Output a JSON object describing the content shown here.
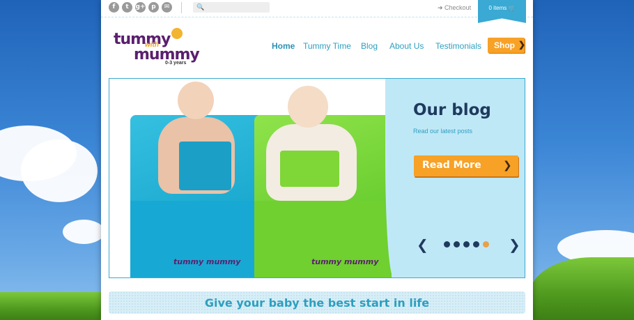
{
  "social": [
    "f",
    "t",
    "g+",
    "p",
    "✉"
  ],
  "search": {
    "icon": "🔍"
  },
  "header": {
    "checkout": "Checkout",
    "cart": "0 items"
  },
  "logo": {
    "line1": "tummy",
    "with": "with",
    "line2": "mummy",
    "age": "0-3 years"
  },
  "nav": [
    "Home",
    "Tummy Time",
    "Blog",
    "About Us",
    "Testimonials"
  ],
  "shop": {
    "label": "Shop",
    "arrow": "❯"
  },
  "slide": {
    "title": "Our blog",
    "subtitle": "Read our latest posts",
    "button": "Read More",
    "button_arrow": "❯",
    "prev": "❮",
    "next": "❯",
    "chair_logo": "tummy mummy"
  },
  "tagline": "Give your baby the best start in life"
}
